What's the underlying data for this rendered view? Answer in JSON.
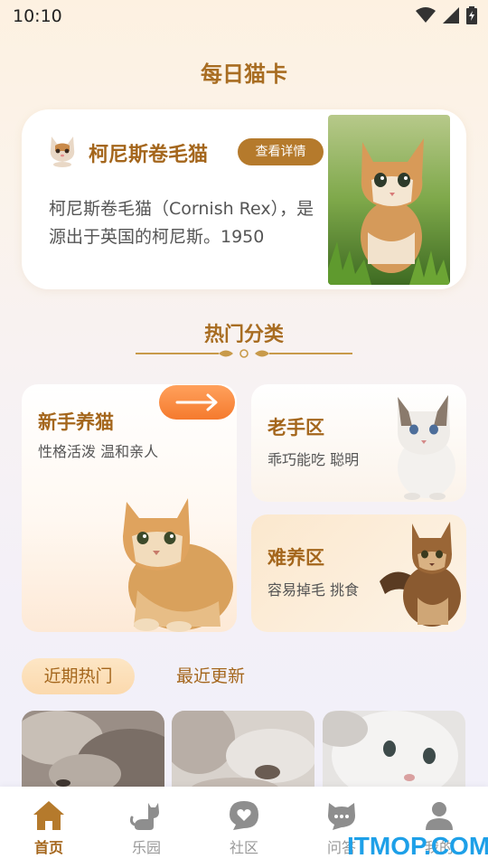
{
  "status_bar": {
    "time": "10:10"
  },
  "page": {
    "title": "每日猫卡"
  },
  "daily_card": {
    "name": "柯尼斯卷毛猫",
    "detail_button": "查看详情",
    "description": "柯尼斯卷毛猫（Cornish Rex），是源出于英国的柯尼斯。1950"
  },
  "categories": {
    "title": "热门分类",
    "items": [
      {
        "title": "新手养猫",
        "subtitle": "性格活泼  温和亲人"
      },
      {
        "title": "老手区",
        "subtitle": "乖巧能吃  聪明"
      },
      {
        "title": "难养区",
        "subtitle": "容易掉毛 挑食"
      }
    ]
  },
  "feed_tabs": {
    "active": "近期热门",
    "inactive": "最近更新"
  },
  "bottom_nav": [
    {
      "label": "首页",
      "icon": "home-icon",
      "active": true
    },
    {
      "label": "乐园",
      "icon": "cat-icon",
      "active": false
    },
    {
      "label": "社区",
      "icon": "heart-chat-icon",
      "active": false
    },
    {
      "label": "问答",
      "icon": "chat-bubble-icon",
      "active": false
    },
    {
      "label": "我的",
      "icon": "user-icon",
      "active": false
    }
  ],
  "watermark": "ITMOP.COM",
  "colors": {
    "accent": "#a4661c",
    "button": "#b57a2c",
    "arrow": "#f57a2e",
    "watermark": "#1ea0e8"
  }
}
